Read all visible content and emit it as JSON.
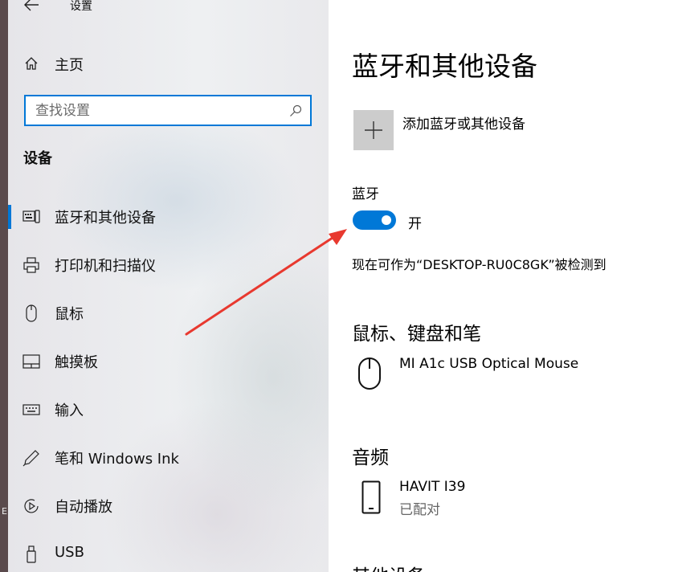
{
  "window": {
    "title": "设置"
  },
  "edge": {
    "partial_text": "E"
  },
  "sidebar": {
    "home_label": "主页",
    "search": {
      "placeholder": "查找设置",
      "value": ""
    },
    "section_title": "设备",
    "items": [
      {
        "label": "蓝牙和其他设备",
        "icon": "bluetooth-devices-icon",
        "active": true
      },
      {
        "label": "打印机和扫描仪",
        "icon": "printer-icon",
        "active": false
      },
      {
        "label": "鼠标",
        "icon": "mouse-icon",
        "active": false
      },
      {
        "label": "触摸板",
        "icon": "touchpad-icon",
        "active": false
      },
      {
        "label": "输入",
        "icon": "keyboard-icon",
        "active": false
      },
      {
        "label": "笔和 Windows Ink",
        "icon": "pen-icon",
        "active": false
      },
      {
        "label": "自动播放",
        "icon": "autoplay-icon",
        "active": false
      },
      {
        "label": "USB",
        "icon": "usb-icon",
        "active": false
      }
    ]
  },
  "main": {
    "title": "蓝牙和其他设备",
    "add_device_label": "添加蓝牙或其他设备",
    "bluetooth": {
      "label": "蓝牙",
      "state": "开",
      "enabled": true,
      "discoverable_text": "现在可作为“DESKTOP-RU0C8GK”被检测到"
    },
    "mouse_section": {
      "title": "鼠标、键盘和笔",
      "devices": [
        {
          "name": "MI A1c USB Optical Mouse",
          "icon": "mouse-icon"
        }
      ]
    },
    "audio_section": {
      "title": "音频",
      "devices": [
        {
          "name": "HAVIT I39",
          "status": "已配对",
          "icon": "phone-icon"
        }
      ]
    },
    "other_section": {
      "title": "其他设备"
    }
  },
  "colors": {
    "accent": "#0078d7",
    "annotation_arrow": "#e8392f",
    "add_button_bg": "#cccccc"
  }
}
